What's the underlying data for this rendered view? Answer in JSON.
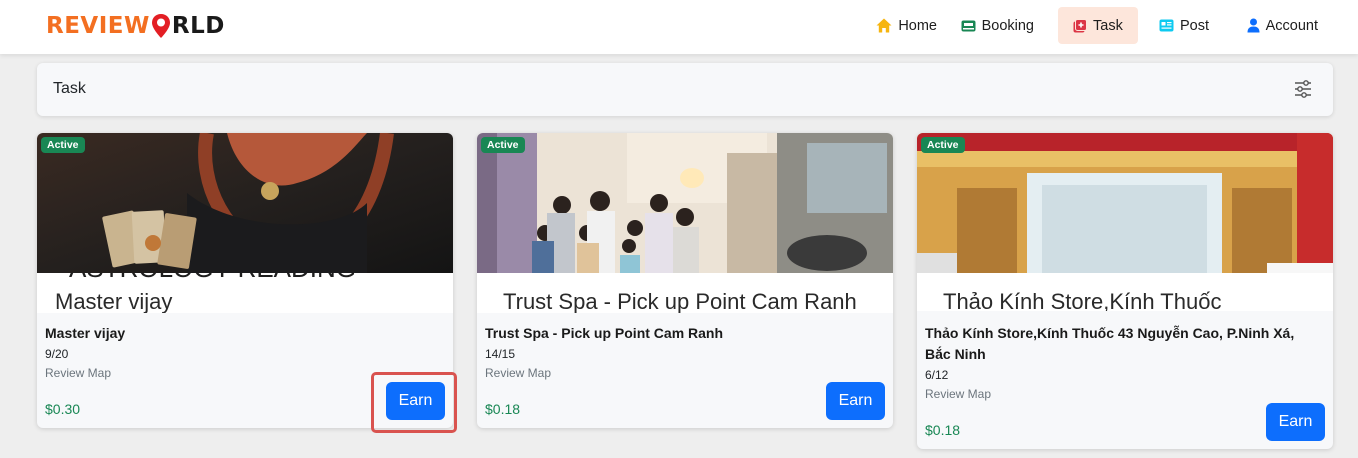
{
  "brand": {
    "logo_part1": "REVIEW",
    "logo_part2": "RLD",
    "logo_pin_icon": "map-pin-icon"
  },
  "nav": {
    "items": [
      {
        "label": "Home",
        "icon": "home-icon"
      },
      {
        "label": "Booking",
        "icon": "booking-icon"
      },
      {
        "label": "Task",
        "icon": "task-icon",
        "active": true
      },
      {
        "label": "Post",
        "icon": "post-icon"
      },
      {
        "label": "Account",
        "icon": "account-icon"
      }
    ]
  },
  "task_header": {
    "title": "Task",
    "filter_icon": "sliders-icon"
  },
  "colors": {
    "brand_orange": "#f36f21",
    "active_nav_bg": "#fde6db",
    "badge_green": "#198754",
    "price_green": "#198754",
    "earn_button": "#0d6efd",
    "highlight_red": "#d9534f"
  },
  "cards": [
    {
      "badge": "Active",
      "image_banner_top": "ASTROLOGY READING",
      "image_banner": "Master vijay",
      "name": "Master vijay",
      "progress": "9/20",
      "category": "Review Map",
      "price": "$0.30",
      "button": "Earn"
    },
    {
      "badge": "Active",
      "image_banner": "Trust Spa - Pick up Point Cam Ranh",
      "name": "Trust Spa - Pick up Point Cam Ranh",
      "progress": "14/15",
      "category": "Review Map",
      "price": "$0.18",
      "button": "Earn"
    },
    {
      "badge": "Active",
      "image_banner": "Thảo Kính Store,Kính Thuốc",
      "name": "Thảo Kính Store,Kính Thuốc 43 Nguyễn Cao, P.Ninh Xá, Bắc Ninh",
      "progress": "6/12",
      "category": "Review Map",
      "price": "$0.18",
      "button": "Earn"
    }
  ]
}
